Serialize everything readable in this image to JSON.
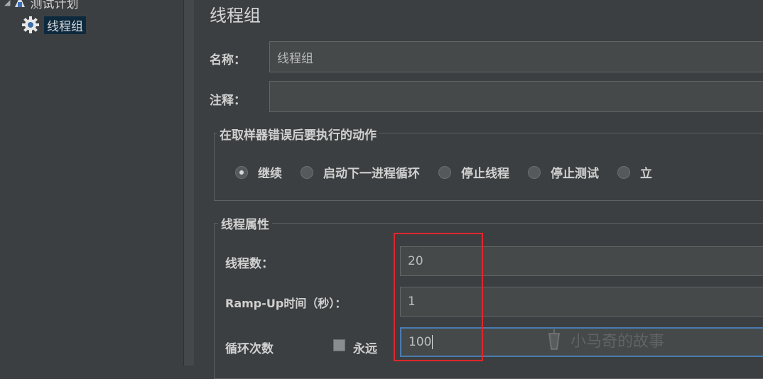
{
  "tree": {
    "plan_label": "测试计划",
    "group_label": "线程组"
  },
  "main": {
    "title": "线程组",
    "name_label": "名称：",
    "name_value": "线程组",
    "comment_label": "注释：",
    "comment_value": "",
    "error_action": {
      "title": "在取样器错误后要执行的动作",
      "options": [
        {
          "label": "继续",
          "selected": true
        },
        {
          "label": "启动下一进程循环",
          "selected": false
        },
        {
          "label": "停止线程",
          "selected": false
        },
        {
          "label": "停止测试",
          "selected": false
        },
        {
          "label": "立",
          "selected": false
        }
      ]
    },
    "thread_props": {
      "title": "线程属性",
      "threads_label": "线程数：",
      "threads_value": "20",
      "rampup_label": "Ramp-Up时间（秒）：",
      "rampup_value": "1",
      "loop_label": "循环次数",
      "forever_label": "永远",
      "forever_checked": false,
      "loop_value": "100"
    }
  },
  "watermark": "小马奇的故事",
  "colors": {
    "background": "#3c3f41",
    "selection": "#0d293e",
    "highlight": "#e0262c"
  }
}
